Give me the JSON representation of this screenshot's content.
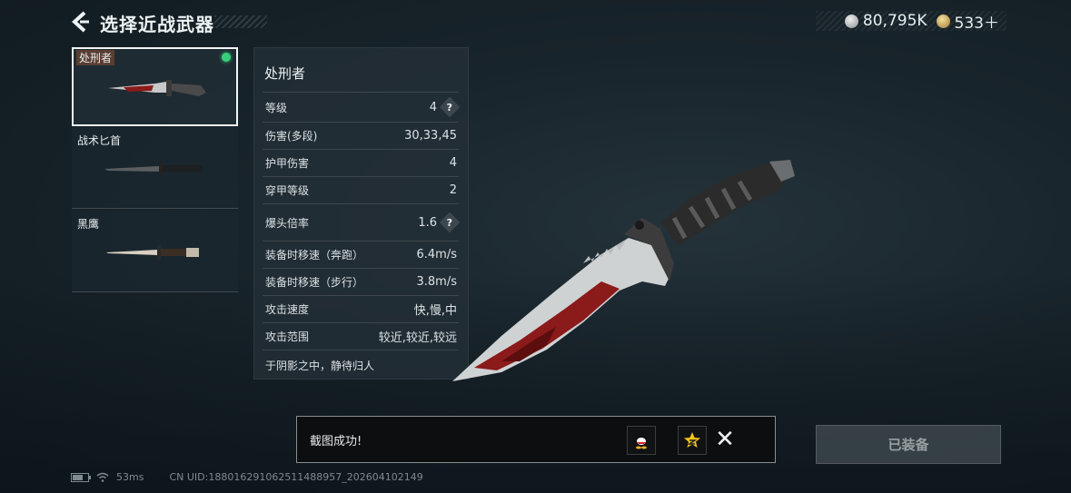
{
  "header": {
    "title": "选择近战武器",
    "back_icon": "chevron-left-icon"
  },
  "currency": {
    "silver": "80,795K",
    "gold": "533＋"
  },
  "weapons": [
    {
      "name": "处刑者",
      "selected": true,
      "equipped": true
    },
    {
      "name": "战术匕首",
      "selected": false,
      "equipped": false
    },
    {
      "name": "黑鹰",
      "selected": false,
      "equipped": false
    }
  ],
  "stats": {
    "title": "处刑者",
    "rows": [
      {
        "label": "等级",
        "value": "4",
        "help": true
      },
      {
        "label": "伤害(多段)",
        "value": "30,33,45",
        "help": false
      },
      {
        "label": "护甲伤害",
        "value": "4",
        "help": false
      },
      {
        "label": "穿甲等级",
        "value": "2",
        "help": false
      },
      {
        "label": "爆头倍率",
        "value": "1.6",
        "help": true
      },
      {
        "label": "装备时移速（奔跑）",
        "value": "6.4m/s",
        "help": false
      },
      {
        "label": "装备时移速（步行）",
        "value": "3.8m/s",
        "help": false
      },
      {
        "label": "攻击速度",
        "value": "快,慢,中",
        "help": false
      },
      {
        "label": "攻击范围",
        "value": "较近,较近,较远",
        "help": false
      }
    ],
    "description": "于阴影之中，静待归人",
    "help_glyph": "?"
  },
  "toast": {
    "message": "截图成功!",
    "close_glyph": "✕"
  },
  "equip_button": {
    "label": "已装备"
  },
  "footer": {
    "ping": "53ms",
    "uid": "CN UID:1880162910625114889​57_202604102149"
  },
  "colors": {
    "equipped_dot": "#35d07a",
    "blood": "#8b1a1a"
  }
}
